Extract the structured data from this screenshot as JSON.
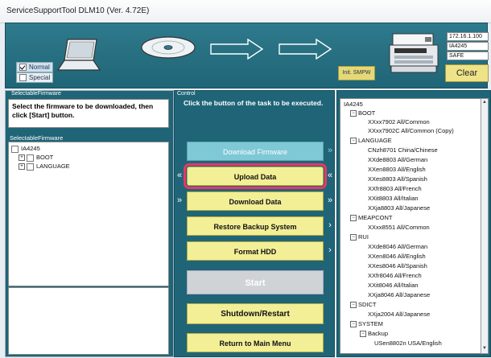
{
  "window": {
    "title": "ServiceSupportTool DLM10 (Ver. 4.72E)"
  },
  "mode": {
    "normal_label": "Normal",
    "special_label": "Special"
  },
  "device_info": {
    "ip": "172.16.1.100",
    "model": "IA4245",
    "status": "SAFE"
  },
  "buttons_top": {
    "init_smpw": "Init. SMPW",
    "clear": "Clear"
  },
  "left": {
    "group_title": "SelectableFirmware",
    "instruction": "Select the firmware to be downloaded, then click [Start] button.",
    "tree_title": "SelectableFirmware",
    "tree": [
      {
        "label": "IA4245"
      },
      {
        "label": "BOOT"
      },
      {
        "label": "LANGUAGE"
      }
    ]
  },
  "control": {
    "group_title": "Control",
    "instruction": "Click the button of the task to be executed.",
    "tasks": [
      {
        "label": "Download Firmware"
      },
      {
        "label": "Upload Data"
      },
      {
        "label": "Download Data"
      },
      {
        "label": "Restore Backup System"
      },
      {
        "label": "Format HDD"
      }
    ],
    "start": "Start",
    "shutdown": "Shutdown/Restart",
    "return": "Return to Main Menu"
  },
  "right_tree": [
    "IA4245",
    "BOOT",
    "XXxx7902  All/Common",
    "XXxx7902C  All/Common (Copy)",
    "LANGUAGE",
    "CNzh8701  China/Chinese",
    "XXde8803  All/German",
    "XXen8803  All/English",
    "XXes8803  All/Spanish",
    "XXfr8803  All/French",
    "XXit8803  All/Italian",
    "XXja8803  All/Japanese",
    "MEAPCONT",
    "XXxx8551  All/Common",
    "RUI",
    "XXde8046  All/German",
    "XXen8046  All/English",
    "XXes8046  All/Spanish",
    "XXfr8046  All/French",
    "XXit8046  All/Italian",
    "XXja8046  All/Japanese",
    "SDICT",
    "XXja2004  All/Japanese",
    "SYSTEM",
    "Backup",
    "USen8802n  USA/English"
  ]
}
